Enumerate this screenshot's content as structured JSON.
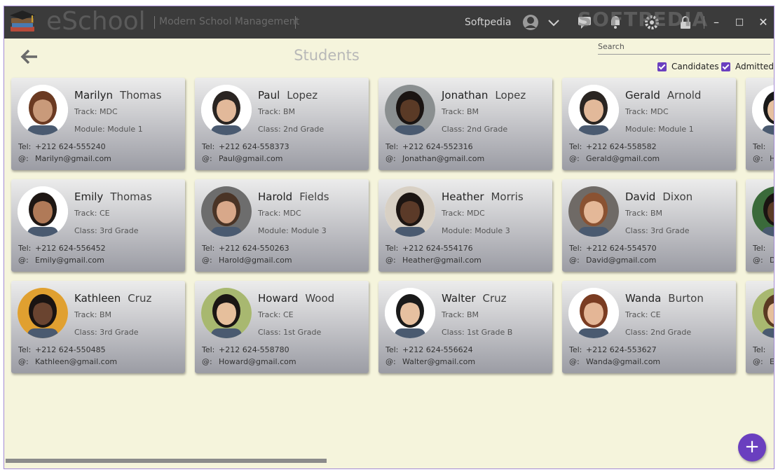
{
  "titlebar": {
    "app_name": "eSchool",
    "subtitle": "Modern School Management",
    "user_name": "Softpedia",
    "watermark": "SOFTPEDIA",
    "minimize": "–",
    "maximize": "□",
    "close": "✕"
  },
  "page": {
    "title": "Students"
  },
  "search": {
    "label": "Search"
  },
  "filters": {
    "candidates": "Candidates",
    "admitted": "Admitted"
  },
  "colors": {
    "accent": "#6a3fbf",
    "titlebar": "#3b3b3b",
    "background": "#f5f4dc"
  },
  "students": [
    {
      "first": "Marilyn",
      "last": "Thomas",
      "track": "Track: MDC",
      "extra": "Module: Module 1",
      "tel_label": "Tel:",
      "tel": "+212 624-555240",
      "mail_label": "@:",
      "email": "Marilyn@gmail.com",
      "skin": "#c99a7a",
      "hair": "#6b3a22",
      "bg": "#ffffff"
    },
    {
      "first": "Paul",
      "last": "Lopez",
      "track": "Track: BM",
      "extra": "Class: 2nd Grade",
      "tel_label": "Tel:",
      "tel": "+212 624-558373",
      "mail_label": "@:",
      "email": "Paul@gmail.com",
      "skin": "#e2b99a",
      "hair": "#2a2522",
      "bg": "#ffffff"
    },
    {
      "first": "Jonathan",
      "last": "Lopez",
      "track": "Track: BM",
      "extra": "Class: 2nd Grade",
      "tel_label": "Tel:",
      "tel": "+212 624-552316",
      "mail_label": "@:",
      "email": "Jonathan@gmail.com",
      "skin": "#5a3a26",
      "hair": "#1a1412",
      "bg": "#8a8f90"
    },
    {
      "first": "Gerald",
      "last": "Arnold",
      "track": "Track: MDC",
      "extra": "Module: Module 1",
      "tel_label": "Tel:",
      "tel": "+212 624-558582",
      "mail_label": "@:",
      "email": "Gerald@gmail.com",
      "skin": "#e2b99a",
      "hair": "#2a2522",
      "bg": "#ffffff"
    },
    {
      "first": "Emily",
      "last": "Thomas",
      "track": "Track: CE",
      "extra": "Class: 3rd Grade",
      "tel_label": "Tel:",
      "tel": "+212 624-556452",
      "mail_label": "@:",
      "email": "Emily@gmail.com",
      "skin": "#b07a58",
      "hair": "#1e1714",
      "bg": "#ffffff"
    },
    {
      "first": "Harold",
      "last": "Fields",
      "track": "Track: MDC",
      "extra": "Module: Module 3",
      "tel_label": "Tel:",
      "tel": "+212 624-550263",
      "mail_label": "@:",
      "email": "Harold@gmail.com",
      "skin": "#d8a88a",
      "hair": "#4a3426",
      "bg": "#6d6d6d"
    },
    {
      "first": "Heather",
      "last": "Morris",
      "track": "Track: MDC",
      "extra": "Module: Module 3",
      "tel_label": "Tel:",
      "tel": "+212 624-554176",
      "mail_label": "@:",
      "email": "Heather@gmail.com",
      "skin": "#5b3a28",
      "hair": "#1c1512",
      "bg": "#d8d0c4"
    },
    {
      "first": "David",
      "last": "Dixon",
      "track": "Track: BM",
      "extra": "Class: 3rd Grade",
      "tel_label": "Tel:",
      "tel": "+212 624-554570",
      "mail_label": "@:",
      "email": "David@gmail.com",
      "skin": "#e4b898",
      "hair": "#8a5232",
      "bg": "#6f6a66"
    },
    {
      "first": "Kathleen",
      "last": "Cruz",
      "track": "Track: BM",
      "extra": "Class: 3rd Grade",
      "tel_label": "Tel:",
      "tel": "+212 624-550485",
      "mail_label": "@:",
      "email": "Kathleen@gmail.com",
      "skin": "#6a4430",
      "hair": "#1a1412",
      "bg": "#e0a030"
    },
    {
      "first": "Howard",
      "last": "Wood",
      "track": "Track: CE",
      "extra": "Class: 1st Grade",
      "tel_label": "Tel:",
      "tel": "+212 624-558780",
      "mail_label": "@:",
      "email": "Howard@gmail.com",
      "skin": "#e6bf9c",
      "hair": "#1b1614",
      "bg": "#a8b870"
    },
    {
      "first": "Walter",
      "last": "Cruz",
      "track": "Track: BM",
      "extra": "Class: 1st Grade B",
      "tel_label": "Tel:",
      "tel": "+212 624-556624",
      "mail_label": "@:",
      "email": "Walter@gmail.com",
      "skin": "#e6c0a0",
      "hair": "#1a1a1a",
      "bg": "#ffffff"
    },
    {
      "first": "Wanda",
      "last": "Burton",
      "track": "Track: CE",
      "extra": "Class: 2nd Grade",
      "tel_label": "Tel:",
      "tel": "+212 624-553627",
      "mail_label": "@:",
      "email": "Wanda@gmail.com",
      "skin": "#e4b696",
      "hair": "#7a3c22",
      "bg": "#ffffff"
    }
  ],
  "partial_cards": [
    {
      "tel_label": "Tel:",
      "mail_label": "@:",
      "mail_initial": "H",
      "skin": "#e6c0a0",
      "hair": "#1a1a1a",
      "bg": "#ffffff"
    },
    {
      "tel_label": "Tel:",
      "mail_label": "@:",
      "mail_initial": "D",
      "skin": "#5a3a26",
      "hair": "#1a1412",
      "bg": "#3a6a3a"
    },
    {
      "tel_label": "Tel:",
      "mail_label": "@:",
      "mail_initial": "E",
      "skin": "#e6bf9c",
      "hair": "#5a3a22",
      "bg": "#a8b870"
    }
  ],
  "fab": {
    "label": "+"
  }
}
